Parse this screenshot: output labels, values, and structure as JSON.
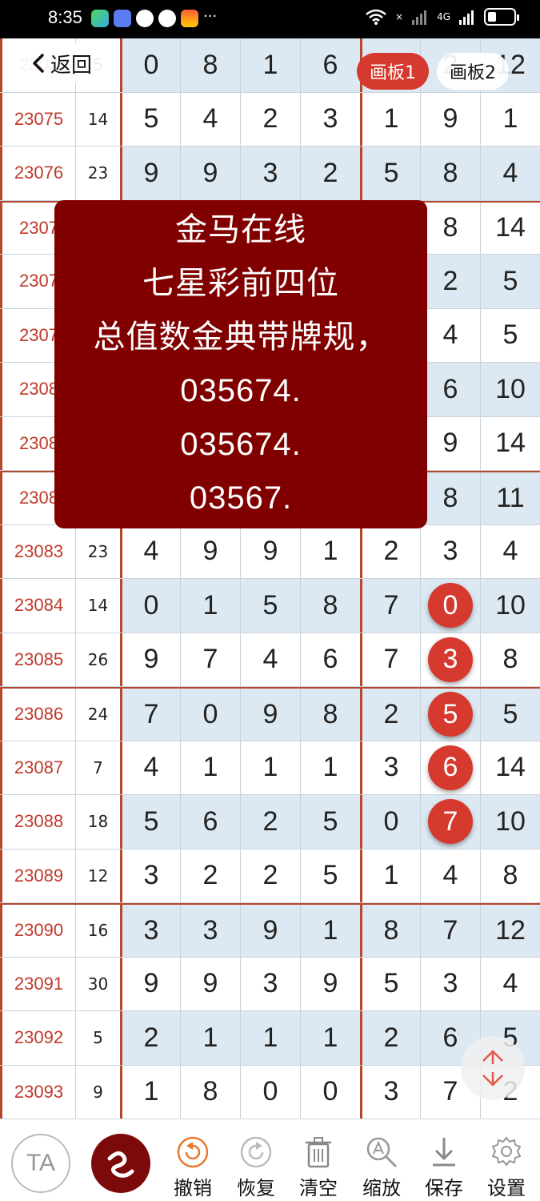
{
  "status_bar": {
    "time": "8:35",
    "network": "4G",
    "wifi_x": "×"
  },
  "nav": {
    "back_label": "返回",
    "tabs": [
      {
        "label": "画板1",
        "active": true
      },
      {
        "label": "画板2",
        "active": false
      }
    ]
  },
  "popup": {
    "lines": [
      "金马在线",
      "七星彩前四位",
      "总值数金典带牌规，",
      "035674.",
      "035674.",
      "03567."
    ]
  },
  "table": {
    "rows": [
      {
        "issue": "2307",
        "sum": "5",
        "d": [
          "0",
          "8",
          "1",
          "6",
          "",
          "2",
          "12"
        ],
        "shade": true,
        "group_top": false
      },
      {
        "issue": "23075",
        "sum": "14",
        "d": [
          "5",
          "4",
          "2",
          "3",
          "1",
          "9",
          "1"
        ],
        "shade": false,
        "group_top": false
      },
      {
        "issue": "23076",
        "sum": "23",
        "d": [
          "9",
          "9",
          "3",
          "2",
          "5",
          "8",
          "4"
        ],
        "shade": true,
        "group_top": false
      },
      {
        "issue": "2307",
        "sum": "",
        "d": [
          "",
          "",
          "",
          "",
          "",
          "8",
          "14"
        ],
        "shade": false,
        "group_top": true
      },
      {
        "issue": "2307",
        "sum": "",
        "d": [
          "",
          "",
          "",
          "",
          "",
          "2",
          "5"
        ],
        "shade": true,
        "group_top": false
      },
      {
        "issue": "2307",
        "sum": "",
        "d": [
          "",
          "",
          "",
          "",
          "",
          "4",
          "5"
        ],
        "shade": false,
        "group_top": false
      },
      {
        "issue": "2308",
        "sum": "",
        "d": [
          "",
          "",
          "",
          "",
          "",
          "6",
          "10"
        ],
        "shade": true,
        "group_top": false
      },
      {
        "issue": "2308",
        "sum": "",
        "d": [
          "",
          "",
          "",
          "",
          "",
          "9",
          "14"
        ],
        "shade": false,
        "group_top": false
      },
      {
        "issue": "2308",
        "sum": "",
        "d": [
          "",
          "",
          "",
          "",
          "",
          "8",
          "11"
        ],
        "shade": true,
        "group_top": true
      },
      {
        "issue": "23083",
        "sum": "23",
        "d": [
          "4",
          "9",
          "9",
          "1",
          "2",
          "3",
          "4"
        ],
        "shade": false,
        "group_top": false
      },
      {
        "issue": "23084",
        "sum": "14",
        "d": [
          "0",
          "1",
          "5",
          "8",
          "7",
          "0",
          "10"
        ],
        "shade": true,
        "group_top": false,
        "circle_col": 5
      },
      {
        "issue": "23085",
        "sum": "26",
        "d": [
          "9",
          "7",
          "4",
          "6",
          "7",
          "3",
          "8"
        ],
        "shade": false,
        "group_top": false,
        "circle_col": 5
      },
      {
        "issue": "23086",
        "sum": "24",
        "d": [
          "7",
          "0",
          "9",
          "8",
          "2",
          "5",
          "5"
        ],
        "shade": true,
        "group_top": true,
        "circle_col": 5
      },
      {
        "issue": "23087",
        "sum": "7",
        "d": [
          "4",
          "1",
          "1",
          "1",
          "3",
          "6",
          "14"
        ],
        "shade": false,
        "group_top": false,
        "circle_col": 5
      },
      {
        "issue": "23088",
        "sum": "18",
        "d": [
          "5",
          "6",
          "2",
          "5",
          "0",
          "7",
          "10"
        ],
        "shade": true,
        "group_top": false,
        "circle_col": 5
      },
      {
        "issue": "23089",
        "sum": "12",
        "d": [
          "3",
          "2",
          "2",
          "5",
          "1",
          "4",
          "8"
        ],
        "shade": false,
        "group_top": false
      },
      {
        "issue": "23090",
        "sum": "16",
        "d": [
          "3",
          "3",
          "9",
          "1",
          "8",
          "7",
          "12"
        ],
        "shade": true,
        "group_top": true
      },
      {
        "issue": "23091",
        "sum": "30",
        "d": [
          "9",
          "9",
          "3",
          "9",
          "5",
          "3",
          "4"
        ],
        "shade": false,
        "group_top": false
      },
      {
        "issue": "23092",
        "sum": "5",
        "d": [
          "2",
          "1",
          "1",
          "1",
          "2",
          "6",
          "5"
        ],
        "shade": true,
        "group_top": false
      },
      {
        "issue": "23093",
        "sum": "9",
        "d": [
          "1",
          "8",
          "0",
          "0",
          "3",
          "7",
          "2"
        ],
        "shade": false,
        "group_top": false
      }
    ]
  },
  "toolbar": {
    "text_tool_label": "TA",
    "items": [
      {
        "label": "撤销",
        "icon": "undo-icon"
      },
      {
        "label": "恢复",
        "icon": "redo-icon"
      },
      {
        "label": "清空",
        "icon": "trash-icon"
      },
      {
        "label": "缩放",
        "icon": "zoom-icon"
      },
      {
        "label": "保存",
        "icon": "download-icon"
      },
      {
        "label": "设置",
        "icon": "gear-icon"
      }
    ]
  },
  "colors": {
    "accent": "#d63a2f",
    "popup_bg": "#800000",
    "issue_text": "#c0392b",
    "shade": "#dde9f2"
  }
}
